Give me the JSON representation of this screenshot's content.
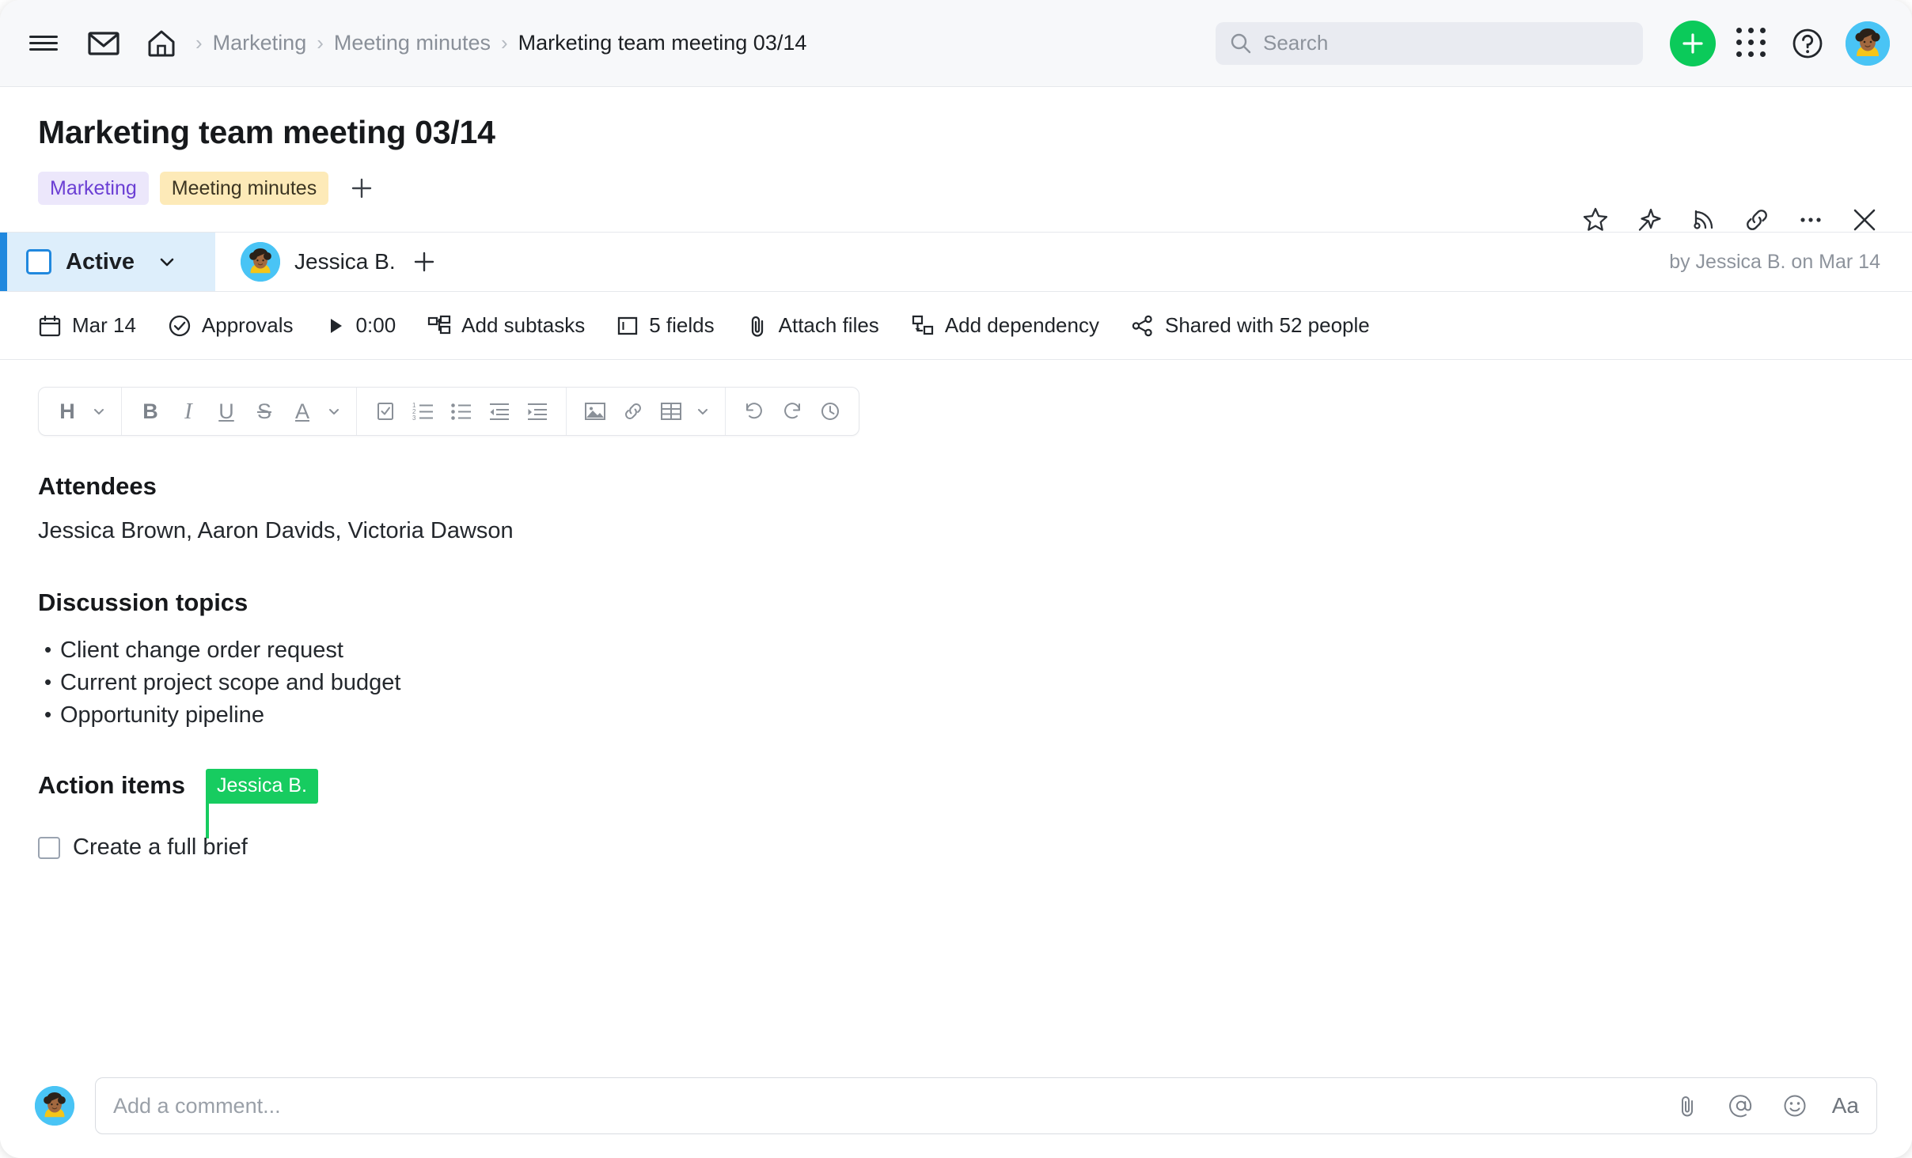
{
  "topbar": {
    "menu_icon": "hamburger-menu-icon",
    "mail_icon": "mail-icon",
    "home_icon": "home-icon",
    "breadcrumb": [
      {
        "label": "Marketing",
        "current": false
      },
      {
        "label": "Meeting minutes",
        "current": false
      },
      {
        "label": "Marketing team meeting 03/14",
        "current": true
      }
    ],
    "separator": "›",
    "search": {
      "placeholder": "Search",
      "value": "",
      "icon": "search-icon"
    },
    "create_button": {
      "label": "+",
      "icon": "plus-icon",
      "color": "#0bca5a"
    },
    "apps_icon": "apps-grid-icon",
    "help_icon": "help-circle-icon",
    "avatar": "user-avatar"
  },
  "header": {
    "title": "Marketing team meeting 03/14",
    "tags": [
      {
        "label": "Marketing",
        "bg": "#ece7fb",
        "fg": "#6b3fd4"
      },
      {
        "label": "Meeting minutes",
        "bg": "#fdeab8",
        "fg": "#3c3522"
      }
    ],
    "add_tag_label": "+",
    "actions": [
      {
        "name": "favorite-star-icon",
        "title": "Add to favorites"
      },
      {
        "name": "pin-icon",
        "title": "Pin"
      },
      {
        "name": "follow-rss-icon",
        "title": "Follow"
      },
      {
        "name": "copy-link-icon",
        "title": "Copy link"
      },
      {
        "name": "more-options-icon",
        "title": "More"
      },
      {
        "name": "close-icon",
        "title": "Close"
      }
    ]
  },
  "status_row": {
    "status_label": "Active",
    "status_color": "#2088de",
    "status_bg": "#ddeefb",
    "assignee": "Jessica B.",
    "add_assignee_label": "+",
    "modified_text": "by Jessica B. on Mar 14"
  },
  "meta_row": [
    {
      "icon": "calendar-icon",
      "label": "Mar 14"
    },
    {
      "icon": "approvals-check-icon",
      "label": "Approvals"
    },
    {
      "icon": "timer-play-icon",
      "label": "0:00"
    },
    {
      "icon": "subtasks-icon",
      "label": "Add subtasks"
    },
    {
      "icon": "fields-icon",
      "label": "5 fields"
    },
    {
      "icon": "attachment-icon",
      "label": "Attach files"
    },
    {
      "icon": "dependency-icon",
      "label": "Add dependency"
    },
    {
      "icon": "share-icon",
      "label": "Shared with 52 people"
    }
  ],
  "toolbar": {
    "groups": [
      [
        {
          "name": "heading-style-button",
          "glyph": "H",
          "caret": true
        }
      ],
      [
        {
          "name": "bold-button",
          "glyph": "B"
        },
        {
          "name": "italic-button",
          "glyph": "I"
        },
        {
          "name": "underline-button",
          "glyph": "U"
        },
        {
          "name": "strikethrough-button",
          "glyph": "S"
        },
        {
          "name": "text-color-button",
          "glyph": "A",
          "caret": true
        }
      ],
      [
        {
          "name": "checklist-button",
          "glyph": ""
        },
        {
          "name": "numbered-list-button",
          "glyph": ""
        },
        {
          "name": "bulleted-list-button",
          "glyph": ""
        },
        {
          "name": "outdent-button",
          "glyph": ""
        },
        {
          "name": "indent-button",
          "glyph": ""
        }
      ],
      [
        {
          "name": "insert-image-button",
          "glyph": ""
        },
        {
          "name": "insert-link-button",
          "glyph": ""
        },
        {
          "name": "insert-table-button",
          "glyph": "",
          "caret": true
        }
      ],
      [
        {
          "name": "undo-button",
          "glyph": ""
        },
        {
          "name": "redo-button",
          "glyph": ""
        },
        {
          "name": "version-history-button",
          "glyph": ""
        }
      ]
    ]
  },
  "document": {
    "attendees_heading": "Attendees",
    "attendees_text": "Jessica Brown, Aaron Davids, Victoria Dawson",
    "discussion_heading": "Discussion topics",
    "discussion_items": [
      "Client change order request",
      "Current project scope and budget",
      "Opportunity pipeline"
    ],
    "action_heading": "Action items",
    "action_item_text": "Create a full brief",
    "collaborator_cursor": {
      "name": "Jessica B.",
      "color": "#17cc60"
    }
  },
  "comment_bar": {
    "placeholder": "Add a comment...",
    "value": "",
    "tools": [
      {
        "name": "attach-file-icon"
      },
      {
        "name": "mention-icon"
      },
      {
        "name": "emoji-icon"
      },
      {
        "name": "text-format-icon",
        "label": "Aa"
      }
    ]
  }
}
